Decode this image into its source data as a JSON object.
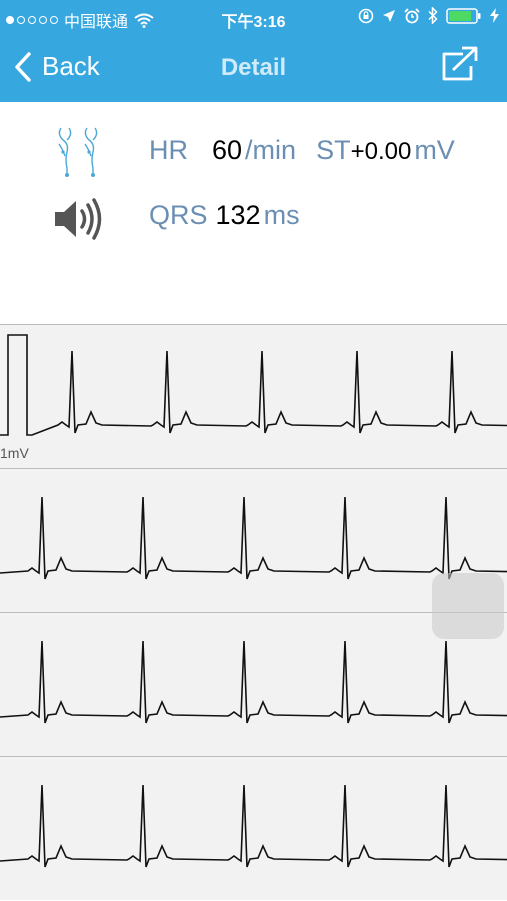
{
  "status_bar": {
    "carrier": "中国联通",
    "time": "下午3:16",
    "signal_dots_filled": 1,
    "signal_dots_total": 5,
    "battery_level": 0.85,
    "icons": [
      "wifi-icon",
      "rotation-lock-icon",
      "location-icon",
      "alarm-icon",
      "bluetooth-icon",
      "battery-icon",
      "charging-icon"
    ]
  },
  "nav": {
    "back_label": "Back",
    "title": "Detail",
    "share_icon": "share-icon"
  },
  "metrics": {
    "hr_label": "HR",
    "hr_value": "60",
    "hr_unit": "/min",
    "st_label": "ST",
    "st_value": "+0.00",
    "st_unit": "mV",
    "qrs_label": "QRS",
    "qrs_value": "132",
    "qrs_unit": "ms",
    "lead_icon": "electrode-leads-icon",
    "sound_icon": "speaker-icon"
  },
  "ecg": {
    "calibration_label": "1mV",
    "strips": 4,
    "heart_rate_bpm": 60
  },
  "colors": {
    "accent": "#37a7e0",
    "label": "#6b8fb2",
    "trace": "#111111",
    "strip_bg": "#f2f2f2"
  }
}
